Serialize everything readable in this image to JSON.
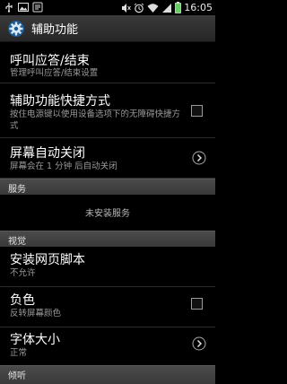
{
  "status_bar": {
    "time": "16:05",
    "left_icons": [
      "usb-icon",
      "image-icon",
      "notification-icon"
    ],
    "right_icons": [
      "mute-icon",
      "alarm-icon",
      "wifi-icon",
      "signal-icon",
      "battery-icon"
    ]
  },
  "header": {
    "title": "辅助功能",
    "icon": "settings-gear-icon"
  },
  "items": [
    {
      "title": "呼叫应答/结束",
      "subtitle": "管理呼叫应答/结束设置"
    },
    {
      "title": "辅助功能快捷方式",
      "subtitle": "按住电源键以使用设备选项下的无障碍快捷方式",
      "checked": false
    },
    {
      "title": "屏幕自动关闭",
      "subtitle": "屏幕会在 1 分钟 后自动关闭"
    }
  ],
  "sections": {
    "services": {
      "label": "服务",
      "empty_text": "未安装服务"
    },
    "vision": {
      "label": "视觉"
    },
    "hearing": {
      "label": "倾听"
    }
  },
  "vision_items": [
    {
      "title": "安装网页脚本",
      "subtitle": "不允许"
    },
    {
      "title": "负色",
      "subtitle": "反转屏幕颜色",
      "checked": false
    },
    {
      "title": "字体大小",
      "subtitle": "正常"
    }
  ]
}
